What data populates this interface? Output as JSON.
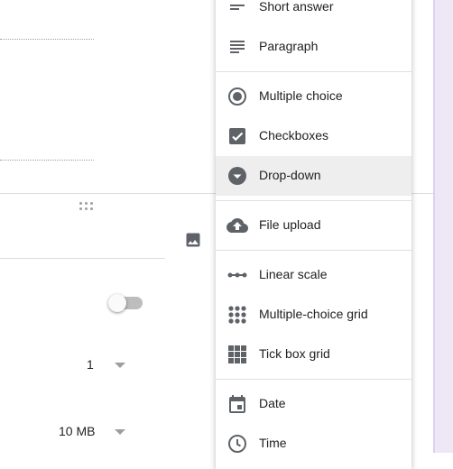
{
  "menu": {
    "items": [
      {
        "label": "Short answer",
        "icon": "short-answer-icon"
      },
      {
        "label": "Paragraph",
        "icon": "paragraph-icon"
      },
      {
        "label": "Multiple choice",
        "icon": "radio-button-icon"
      },
      {
        "label": "Checkboxes",
        "icon": "checkbox-icon"
      },
      {
        "label": "Drop-down",
        "icon": "dropdown-circle-icon",
        "selected": true
      },
      {
        "label": "File upload",
        "icon": "cloud-upload-icon"
      },
      {
        "label": "Linear scale",
        "icon": "linear-scale-icon"
      },
      {
        "label": "Multiple-choice grid",
        "icon": "multiple-choice-grid-icon"
      },
      {
        "label": "Tick box grid",
        "icon": "tick-box-grid-icon"
      },
      {
        "label": "Date",
        "icon": "calendar-icon"
      },
      {
        "label": "Time",
        "icon": "clock-icon"
      }
    ]
  },
  "settings": {
    "max_files_value": "1",
    "max_size_value": "10 MB",
    "toggle_on": false
  },
  "colors": {
    "icon": "#5f6368",
    "selected_bg": "#eeeeee",
    "accent_strip": "#ede7f6"
  }
}
